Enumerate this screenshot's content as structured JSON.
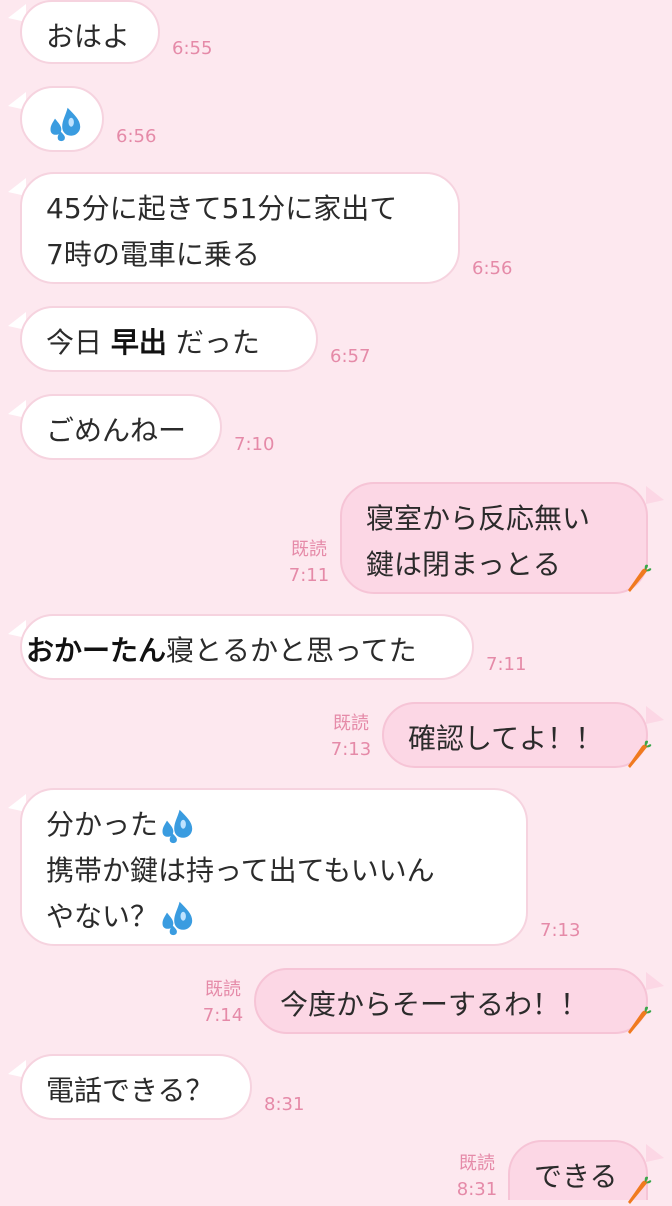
{
  "messages": [
    {
      "side": "in",
      "text": "おはよ",
      "time": "6:55"
    },
    {
      "side": "in",
      "icon": "sweat-drops-icon",
      "time": "6:56"
    },
    {
      "side": "in",
      "lines": [
        "45分に起きて51分に家出て",
        "7時の電車に乗る"
      ],
      "time": "6:56"
    },
    {
      "side": "in",
      "parts": [
        "今日 ",
        "早出",
        " だった"
      ],
      "time": "6:57"
    },
    {
      "side": "in",
      "text": "ごめんねー",
      "time": "7:10"
    },
    {
      "side": "out",
      "lines": [
        "寝室から反応無い",
        "鍵は閉まっとる"
      ],
      "read": "既読",
      "time": "7:11"
    },
    {
      "side": "in",
      "parts": [
        "おかーたん",
        "寝とるかと思ってた"
      ],
      "time": "7:11"
    },
    {
      "side": "out",
      "text": "確認してよ！！",
      "read": "既読",
      "time": "7:13"
    },
    {
      "side": "in",
      "lines": [
        "分かった",
        "携帯か鍵は持って出てもいいん",
        "やない？"
      ],
      "time": "7:13"
    },
    {
      "side": "out",
      "text": "今度からそーするわ！！",
      "read": "既読",
      "time": "7:14"
    },
    {
      "side": "in",
      "text": "電話できる？",
      "time": "8:31"
    },
    {
      "side": "out",
      "text": "できる",
      "read": "既読",
      "time": "8:31"
    }
  ],
  "colors": {
    "background": "#fde8ef",
    "incoming": "#ffffff",
    "outgoing": "#fcd7e5",
    "meta": "#e58aa8"
  }
}
